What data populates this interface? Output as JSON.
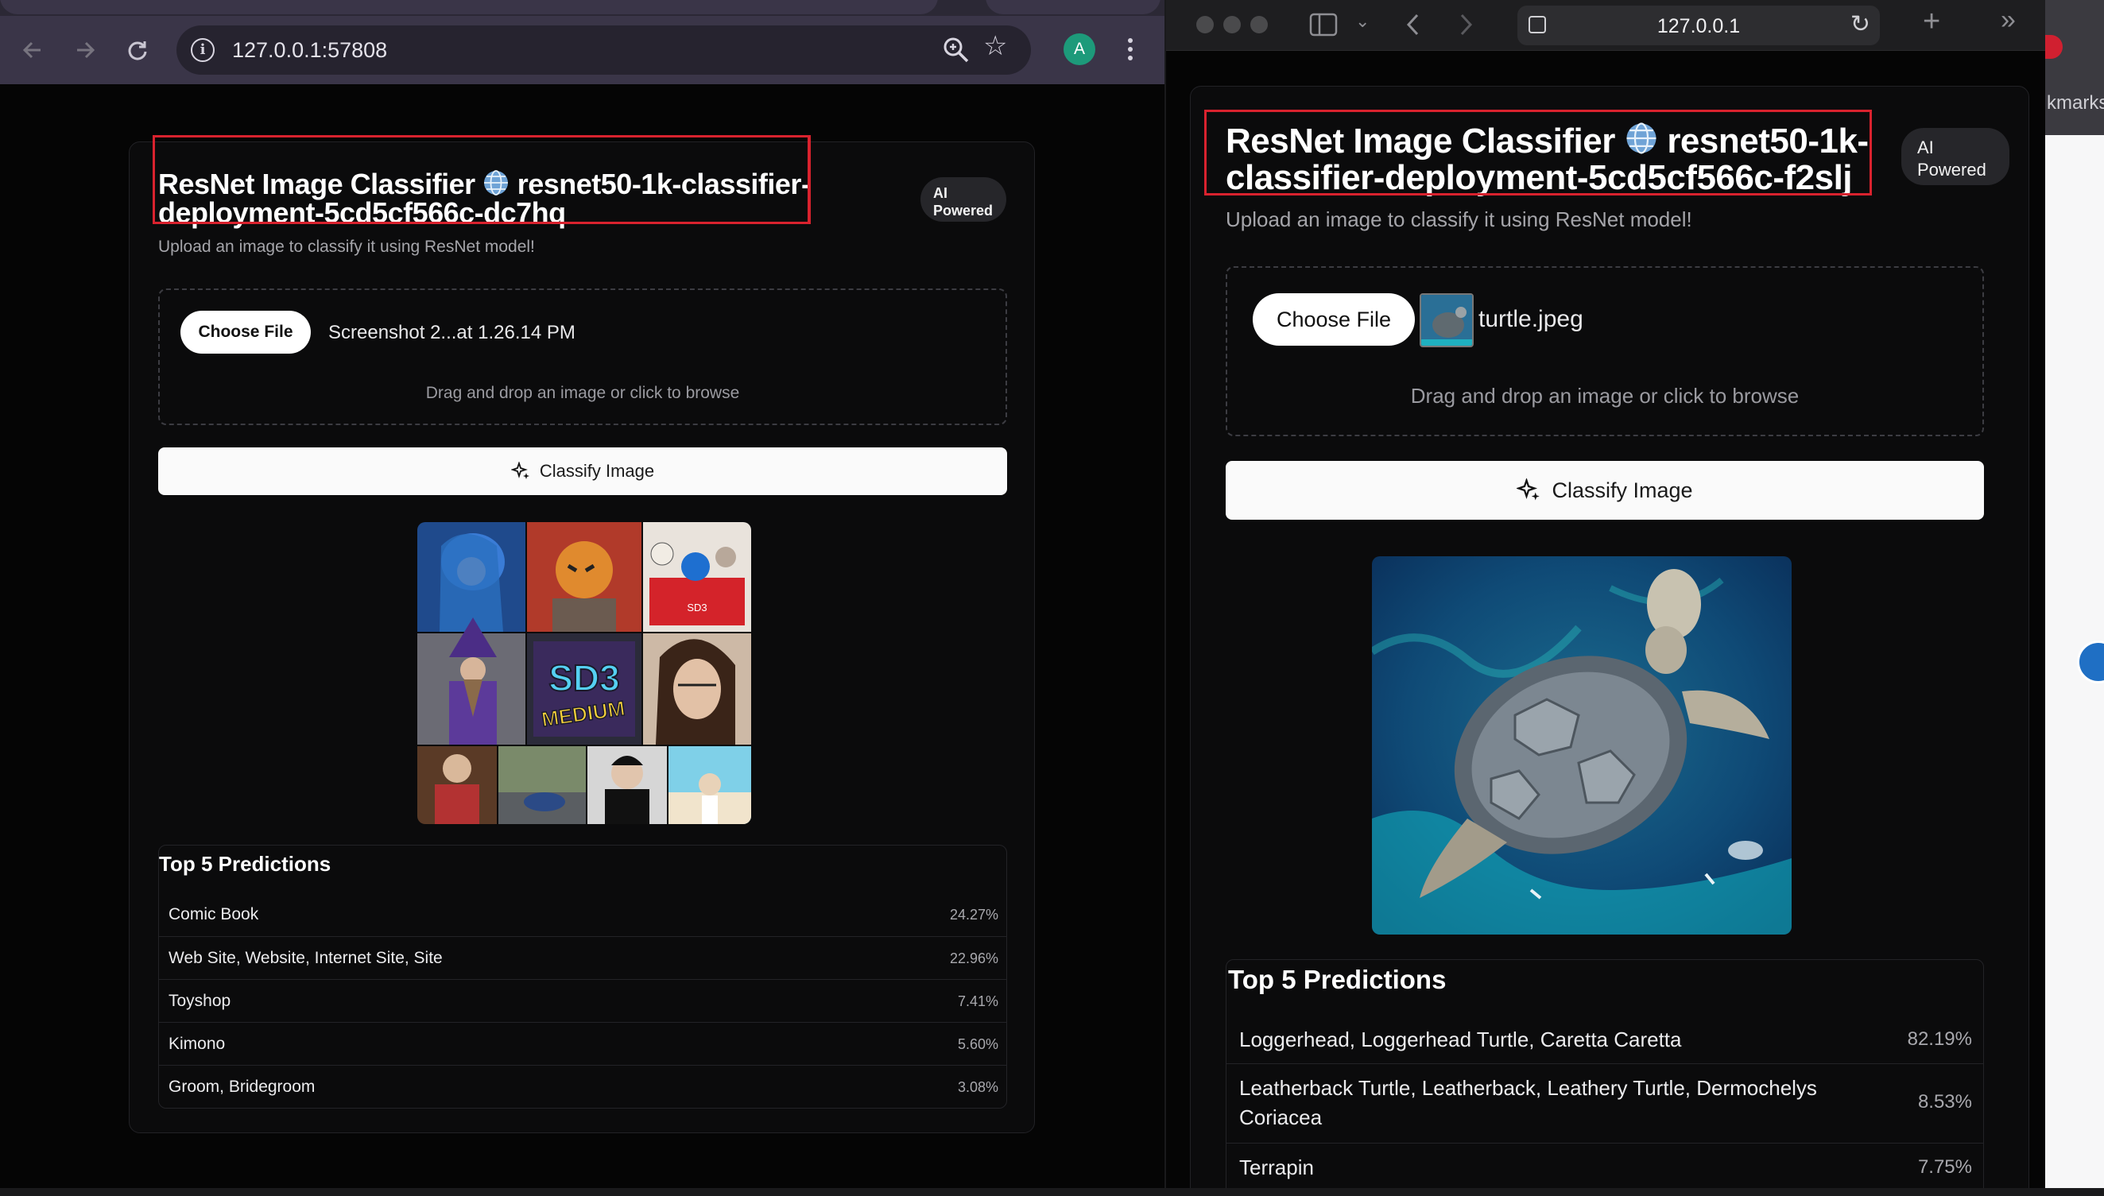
{
  "left_browser": {
    "url": "127.0.0.1:57808",
    "profile_initial": "A",
    "app": {
      "title": "ResNet Image Classifier",
      "deployment": "resnet50-1k-classifier-deployment-5cd5cf566c-dc7hq",
      "badge_line1": "AI",
      "badge_line2": "Powered",
      "subtitle": "Upload an image to classify it using ResNet model!",
      "choose_file_label": "Choose File",
      "filename": "Screenshot 2...at 1.26.14 PM",
      "drop_hint": "Drag and drop an image or click to browse",
      "classify_label": "Classify Image",
      "preview_text": "SD3",
      "preview_text_2": "MEDIUM",
      "preview_sign": "SD3",
      "predictions_title": "Top 5 Predictions",
      "predictions": [
        {
          "label": "Comic Book",
          "pct": "24.27%"
        },
        {
          "label": "Web Site, Website, Internet Site, Site",
          "pct": "22.96%"
        },
        {
          "label": "Toyshop",
          "pct": "7.41%"
        },
        {
          "label": "Kimono",
          "pct": "5.60%"
        },
        {
          "label": "Groom, Bridegroom",
          "pct": "3.08%"
        }
      ]
    }
  },
  "right_browser": {
    "url": "127.0.0.1",
    "app": {
      "title": "ResNet Image Classifier",
      "deployment": "resnet50-1k-classifier-deployment-5cd5cf566c-f2slj",
      "badge_line1": "AI",
      "badge_line2": "Powered",
      "subtitle": "Upload an image to classify it using ResNet model!",
      "choose_file_label": "Choose File",
      "filename": "turtle.jpeg",
      "drop_hint": "Drag and drop an image or click to browse",
      "classify_label": "Classify Image",
      "predictions_title": "Top 5 Predictions",
      "predictions": [
        {
          "label": "Loggerhead, Loggerhead Turtle, Caretta Caretta",
          "pct": "82.19%"
        },
        {
          "label": "Leatherback Turtle, Leatherback, Leathery Turtle, Dermochelys Coriacea",
          "pct": "8.53%"
        },
        {
          "label": "Terrapin",
          "pct": "7.75%"
        }
      ]
    }
  },
  "third_window": {
    "bookmarks_fragment": "kmarks"
  },
  "colors": {
    "highlight": "#d9222e",
    "profile": "#1d9a7a"
  },
  "icons": [
    "back-icon",
    "forward-icon",
    "reload-icon",
    "info-icon",
    "zoom-icon",
    "star-icon",
    "more-icon",
    "globe-icon",
    "sparkles-icon",
    "sidebar-icon",
    "chevron-down-icon",
    "new-tab-icon",
    "overflow-icon"
  ]
}
